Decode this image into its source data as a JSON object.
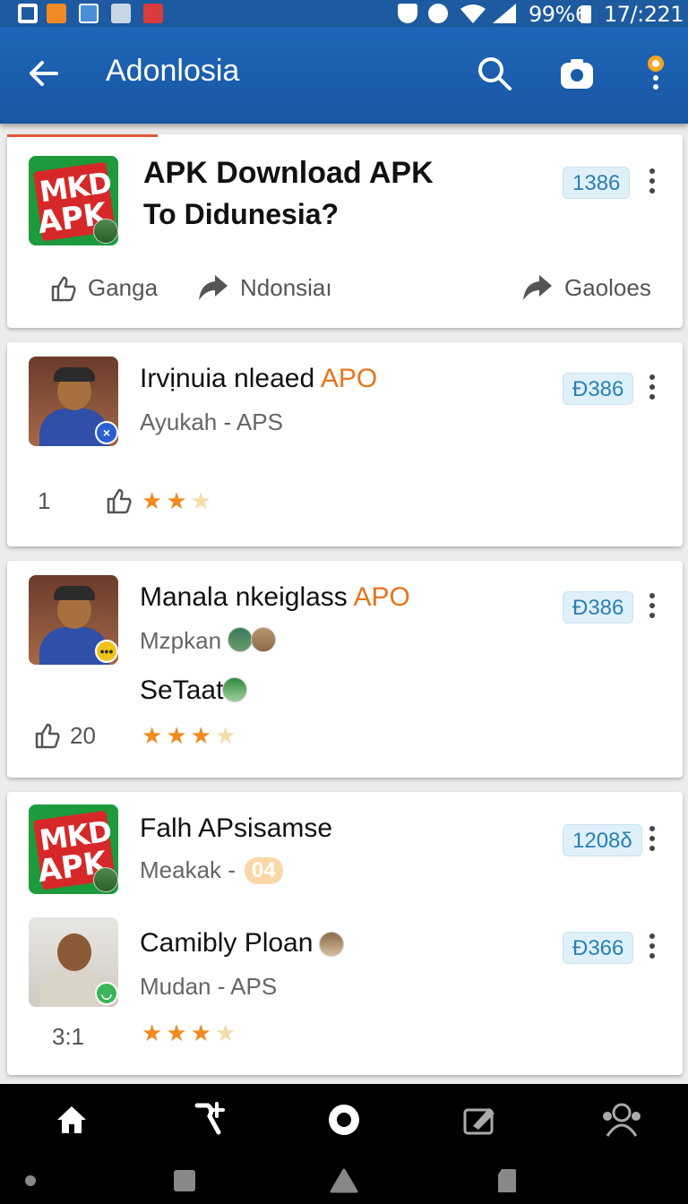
{
  "status_bar": {
    "battery": "99%6",
    "time": "17/:221"
  },
  "app_bar": {
    "title": "Adonlosia"
  },
  "featured": {
    "title_line1": "APK Download APK",
    "title_line2": "To Didunesia?",
    "badge": "1386",
    "logo_text_1": "MKD",
    "logo_text_2": "APK",
    "actions": [
      "Ganga",
      "Ndonsiaı",
      "Gaoloes"
    ]
  },
  "items": [
    {
      "title": "Irvịnuia nleaed",
      "title_suffix": "APO",
      "subtitle": "Ayukah - APS",
      "badge": "Ɖ386",
      "count": "1",
      "stars_filled": 2,
      "stars_total": 3
    },
    {
      "title": "Manala nkeiglass",
      "title_suffix": "APO",
      "subtitle": "Mzpkan",
      "extra": "SeTaat",
      "badge": "Ɖ386",
      "count": "20",
      "stars_filled": 3,
      "stars_total": 4
    },
    {
      "title": "Falh APsisamse",
      "subtitle": "Meakak -",
      "subtitle_badge": "04",
      "badge": "1208δ",
      "logo_text_1": "MKD",
      "logo_text_2": "APK"
    },
    {
      "title": "Camibly Ploan",
      "subtitle": "Mudan - APS",
      "badge": "Ɖ366",
      "count": "3:1",
      "stars_filled": 3,
      "stars_total": 4
    }
  ],
  "colors": {
    "app_bar": "#1e5aa0",
    "accent": "#e8731c",
    "star": "#ef8a1f",
    "badge_bg": "#dff0f8"
  }
}
